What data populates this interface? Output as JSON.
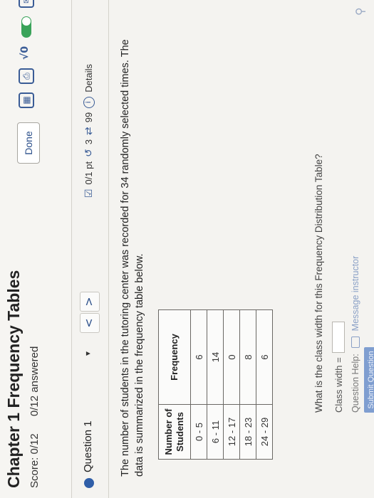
{
  "header": {
    "title": "Chapter 1 Frequency Tables",
    "score": "Score: 0/12",
    "answered": "0/12 answered",
    "done_label": "Done"
  },
  "toolbar_icons": [
    "calculator-icon",
    "print-icon",
    "sqrt-icon",
    "toggle-switch",
    "message-icon",
    "more-menu-icon"
  ],
  "toolbar_text": {
    "sqrt_glyph": "√0"
  },
  "question_bar": {
    "label": "Question 1",
    "dropdown_glyph": "▾",
    "prev_glyph": "<",
    "next_glyph": ">",
    "points": "0/1 pt",
    "retries": "3",
    "attempts": "99",
    "details": "Details"
  },
  "prompt": "The number of students in the tutoring center was recorded for 34 randomly selected times. The data is summarized in the frequency table below.",
  "table": {
    "headers": [
      "Number of Students",
      "Frequency"
    ],
    "rows": [
      [
        "0 - 5",
        "6"
      ],
      [
        "6 - 11",
        "14"
      ],
      [
        "12 - 17",
        "0"
      ],
      [
        "18 - 23",
        "8"
      ],
      [
        "24 - 29",
        "6"
      ]
    ]
  },
  "question": "What is the class width for this Frequency Distribution Table?",
  "answer": {
    "label": "Class width =",
    "value": ""
  },
  "help": {
    "label": "Question Help:",
    "link": "Message instructor"
  },
  "submit_label": "Submit Question",
  "colors": {
    "accent": "#2f5ea8",
    "toggle": "#3aa35a",
    "submit": "#7f9ed0"
  }
}
